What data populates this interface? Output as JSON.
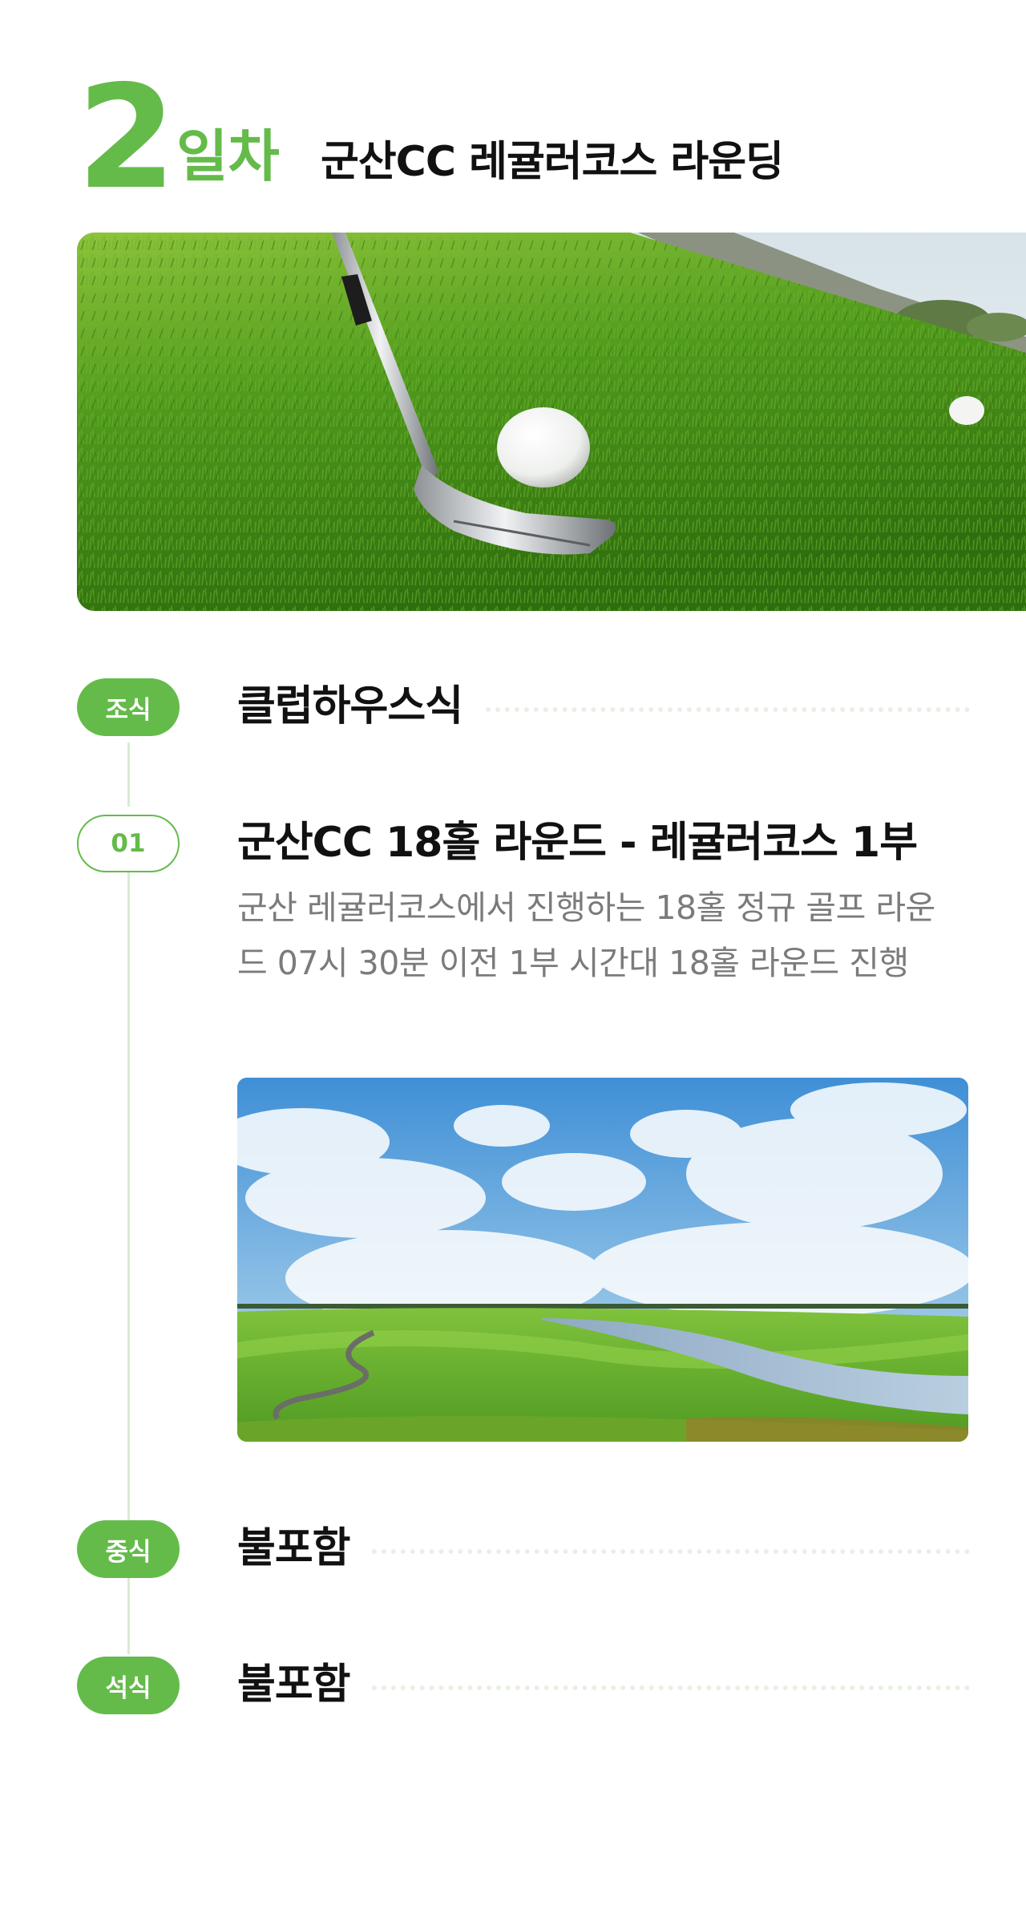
{
  "theme": {
    "accent": "#64bb4a",
    "text": "#111111",
    "muted": "#7b7b7b",
    "line": "#d8ecd3",
    "dots": "#e7f1e3"
  },
  "day": {
    "number": "2",
    "unit": "일차",
    "title": "군산CC 레귤러코스 라운딩"
  },
  "hero_image": {
    "icon": "golf-club-ball-photo"
  },
  "schedule": {
    "breakfast": {
      "tag": "조식",
      "value": "클럽하우스식"
    },
    "item": {
      "tag": "01",
      "title": "군산CC 18홀 라운드 - 레귤러코스 1부",
      "description": "군산 레귤러코스에서 진행하는 18홀 정규 골프 라운드 07시 30분 이전 1부 시간대 18홀 라운드 진행",
      "image": "golf-course-lake-photo"
    },
    "lunch": {
      "tag": "중식",
      "value": "불포함"
    },
    "dinner": {
      "tag": "석식",
      "value": "불포함"
    }
  }
}
